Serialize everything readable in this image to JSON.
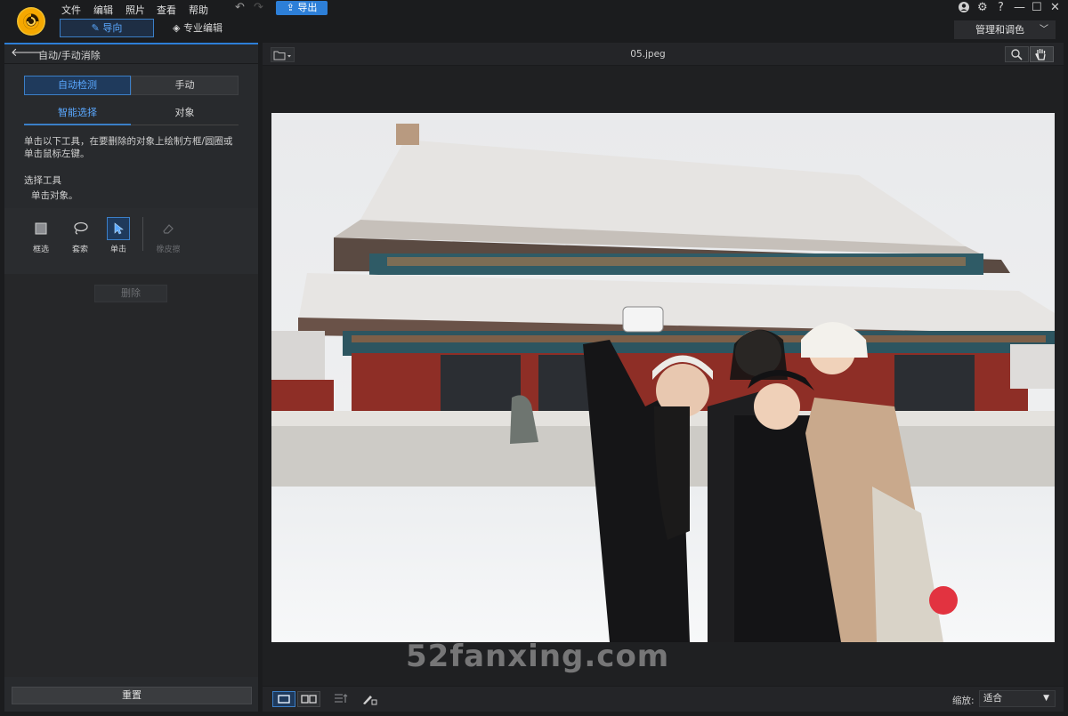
{
  "app": {
    "menus": [
      "文件",
      "编辑",
      "照片",
      "查看",
      "帮助"
    ],
    "export_label": "导出",
    "window_controls": [
      "?",
      "—",
      "☐",
      "✕"
    ]
  },
  "modes": {
    "guide_label": "导向",
    "pro_label": "专业编辑",
    "manage_label": "管理和调色"
  },
  "left_panel": {
    "title": "自动/手动消除",
    "segments": {
      "auto": "自动检测",
      "manual": "手动"
    },
    "subtabs": {
      "smart": "智能选择",
      "object": "对象"
    },
    "instructions": "单击以下工具，在要删除的对象上绘制方框/圆圈或单击鼠标左键。",
    "tools_label": "选择工具",
    "tools_hint": "单击对象。",
    "tools": [
      {
        "label": "框选",
        "icon": "box-select-icon",
        "active": false
      },
      {
        "label": "套索",
        "icon": "lasso-icon",
        "active": false
      },
      {
        "label": "单击",
        "icon": "click-select-icon",
        "active": true
      },
      {
        "label": "橡皮擦",
        "icon": "eraser-icon",
        "active": false,
        "disabled": true
      }
    ],
    "delete_label": "删除",
    "reset_label": "重置"
  },
  "viewer": {
    "filename": "05.jpeg",
    "zoom_label": "缩放:",
    "zoom_value": "适合"
  },
  "watermark": "52fanxing.com",
  "colors": {
    "accent": "#2d7fd8",
    "active_bg": "#1f3a5c",
    "active_text": "#5aa8ff"
  }
}
